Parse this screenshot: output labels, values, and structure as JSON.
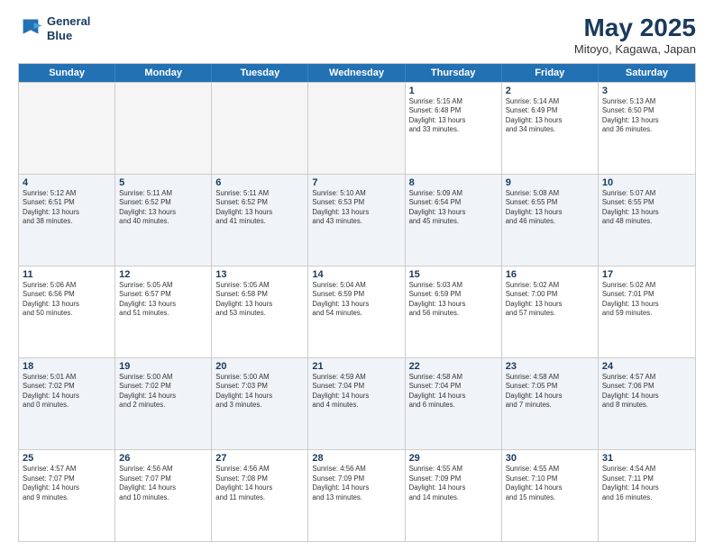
{
  "logo": {
    "line1": "General",
    "line2": "Blue"
  },
  "title": "May 2025",
  "location": "Mitoyo, Kagawa, Japan",
  "days": [
    "Sunday",
    "Monday",
    "Tuesday",
    "Wednesday",
    "Thursday",
    "Friday",
    "Saturday"
  ],
  "rows": [
    [
      {
        "day": "",
        "info": ""
      },
      {
        "day": "",
        "info": ""
      },
      {
        "day": "",
        "info": ""
      },
      {
        "day": "",
        "info": ""
      },
      {
        "day": "1",
        "info": "Sunrise: 5:15 AM\nSunset: 6:48 PM\nDaylight: 13 hours\nand 33 minutes."
      },
      {
        "day": "2",
        "info": "Sunrise: 5:14 AM\nSunset: 6:49 PM\nDaylight: 13 hours\nand 34 minutes."
      },
      {
        "day": "3",
        "info": "Sunrise: 5:13 AM\nSunset: 6:50 PM\nDaylight: 13 hours\nand 36 minutes."
      }
    ],
    [
      {
        "day": "4",
        "info": "Sunrise: 5:12 AM\nSunset: 6:51 PM\nDaylight: 13 hours\nand 38 minutes."
      },
      {
        "day": "5",
        "info": "Sunrise: 5:11 AM\nSunset: 6:52 PM\nDaylight: 13 hours\nand 40 minutes."
      },
      {
        "day": "6",
        "info": "Sunrise: 5:11 AM\nSunset: 6:52 PM\nDaylight: 13 hours\nand 41 minutes."
      },
      {
        "day": "7",
        "info": "Sunrise: 5:10 AM\nSunset: 6:53 PM\nDaylight: 13 hours\nand 43 minutes."
      },
      {
        "day": "8",
        "info": "Sunrise: 5:09 AM\nSunset: 6:54 PM\nDaylight: 13 hours\nand 45 minutes."
      },
      {
        "day": "9",
        "info": "Sunrise: 5:08 AM\nSunset: 6:55 PM\nDaylight: 13 hours\nand 46 minutes."
      },
      {
        "day": "10",
        "info": "Sunrise: 5:07 AM\nSunset: 6:55 PM\nDaylight: 13 hours\nand 48 minutes."
      }
    ],
    [
      {
        "day": "11",
        "info": "Sunrise: 5:06 AM\nSunset: 6:56 PM\nDaylight: 13 hours\nand 50 minutes."
      },
      {
        "day": "12",
        "info": "Sunrise: 5:05 AM\nSunset: 6:57 PM\nDaylight: 13 hours\nand 51 minutes."
      },
      {
        "day": "13",
        "info": "Sunrise: 5:05 AM\nSunset: 6:58 PM\nDaylight: 13 hours\nand 53 minutes."
      },
      {
        "day": "14",
        "info": "Sunrise: 5:04 AM\nSunset: 6:59 PM\nDaylight: 13 hours\nand 54 minutes."
      },
      {
        "day": "15",
        "info": "Sunrise: 5:03 AM\nSunset: 6:59 PM\nDaylight: 13 hours\nand 56 minutes."
      },
      {
        "day": "16",
        "info": "Sunrise: 5:02 AM\nSunset: 7:00 PM\nDaylight: 13 hours\nand 57 minutes."
      },
      {
        "day": "17",
        "info": "Sunrise: 5:02 AM\nSunset: 7:01 PM\nDaylight: 13 hours\nand 59 minutes."
      }
    ],
    [
      {
        "day": "18",
        "info": "Sunrise: 5:01 AM\nSunset: 7:02 PM\nDaylight: 14 hours\nand 0 minutes."
      },
      {
        "day": "19",
        "info": "Sunrise: 5:00 AM\nSunset: 7:02 PM\nDaylight: 14 hours\nand 2 minutes."
      },
      {
        "day": "20",
        "info": "Sunrise: 5:00 AM\nSunset: 7:03 PM\nDaylight: 14 hours\nand 3 minutes."
      },
      {
        "day": "21",
        "info": "Sunrise: 4:59 AM\nSunset: 7:04 PM\nDaylight: 14 hours\nand 4 minutes."
      },
      {
        "day": "22",
        "info": "Sunrise: 4:58 AM\nSunset: 7:04 PM\nDaylight: 14 hours\nand 6 minutes."
      },
      {
        "day": "23",
        "info": "Sunrise: 4:58 AM\nSunset: 7:05 PM\nDaylight: 14 hours\nand 7 minutes."
      },
      {
        "day": "24",
        "info": "Sunrise: 4:57 AM\nSunset: 7:06 PM\nDaylight: 14 hours\nand 8 minutes."
      }
    ],
    [
      {
        "day": "25",
        "info": "Sunrise: 4:57 AM\nSunset: 7:07 PM\nDaylight: 14 hours\nand 9 minutes."
      },
      {
        "day": "26",
        "info": "Sunrise: 4:56 AM\nSunset: 7:07 PM\nDaylight: 14 hours\nand 10 minutes."
      },
      {
        "day": "27",
        "info": "Sunrise: 4:56 AM\nSunset: 7:08 PM\nDaylight: 14 hours\nand 11 minutes."
      },
      {
        "day": "28",
        "info": "Sunrise: 4:56 AM\nSunset: 7:09 PM\nDaylight: 14 hours\nand 13 minutes."
      },
      {
        "day": "29",
        "info": "Sunrise: 4:55 AM\nSunset: 7:09 PM\nDaylight: 14 hours\nand 14 minutes."
      },
      {
        "day": "30",
        "info": "Sunrise: 4:55 AM\nSunset: 7:10 PM\nDaylight: 14 hours\nand 15 minutes."
      },
      {
        "day": "31",
        "info": "Sunrise: 4:54 AM\nSunset: 7:11 PM\nDaylight: 14 hours\nand 16 minutes."
      }
    ]
  ]
}
